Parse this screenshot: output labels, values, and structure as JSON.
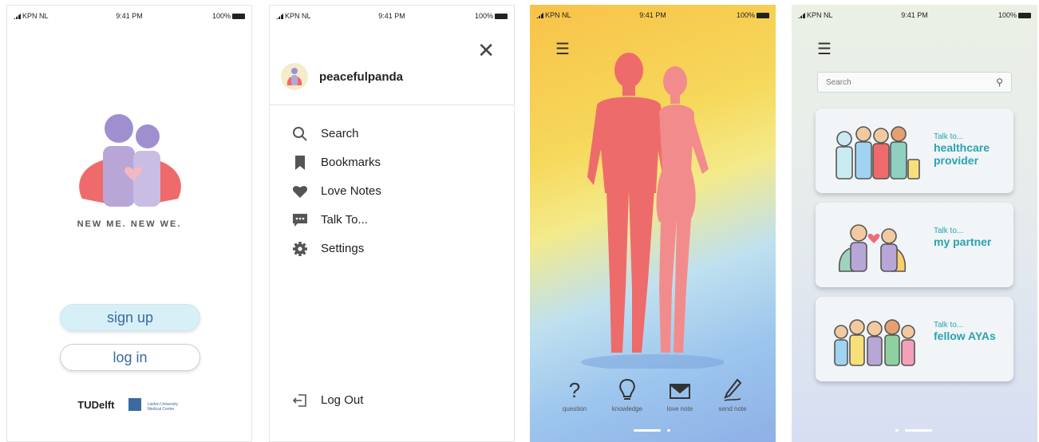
{
  "status": {
    "carrier": "KPN NL",
    "time": "9:41 PM",
    "battery": "100%"
  },
  "welcome": {
    "tagline": "NEW ME. NEW WE.",
    "signup_label": "sign up",
    "login_label": "log in",
    "logo_tudelft": "TUDelft",
    "logo_lumc_text": "Leiden University Medical Center"
  },
  "menu": {
    "username": "peacefulpanda",
    "items": [
      {
        "label": "Search",
        "icon": "search-icon"
      },
      {
        "label": "Bookmarks",
        "icon": "bookmark-icon"
      },
      {
        "label": "Love Notes",
        "icon": "heart-icon"
      },
      {
        "label": "Talk To...",
        "icon": "chat-icon"
      },
      {
        "label": "Settings",
        "icon": "gear-icon"
      }
    ],
    "logout_label": "Log Out"
  },
  "body_screen": {
    "tools": [
      {
        "label": "question",
        "icon": "question-icon"
      },
      {
        "label": "knowledge",
        "icon": "lightbulb-icon"
      },
      {
        "label": "love note",
        "icon": "envelope-icon"
      },
      {
        "label": "send note",
        "icon": "pen-icon"
      }
    ]
  },
  "talk_screen": {
    "search_placeholder": "Search",
    "cards": [
      {
        "pre": "Talk to...",
        "title_line1": "healthcare",
        "title_line2": "provider"
      },
      {
        "pre": "Talk to...",
        "title_line1": "my partner",
        "title_line2": ""
      },
      {
        "pre": "Talk to...",
        "title_line1": "fellow AYAs",
        "title_line2": ""
      }
    ]
  },
  "colors": {
    "accent_teal": "#2aa3b0",
    "signup_bg": "#d7eff7",
    "cape_red": "#ef6a6a",
    "figure_purple": "#b8a6d6"
  }
}
